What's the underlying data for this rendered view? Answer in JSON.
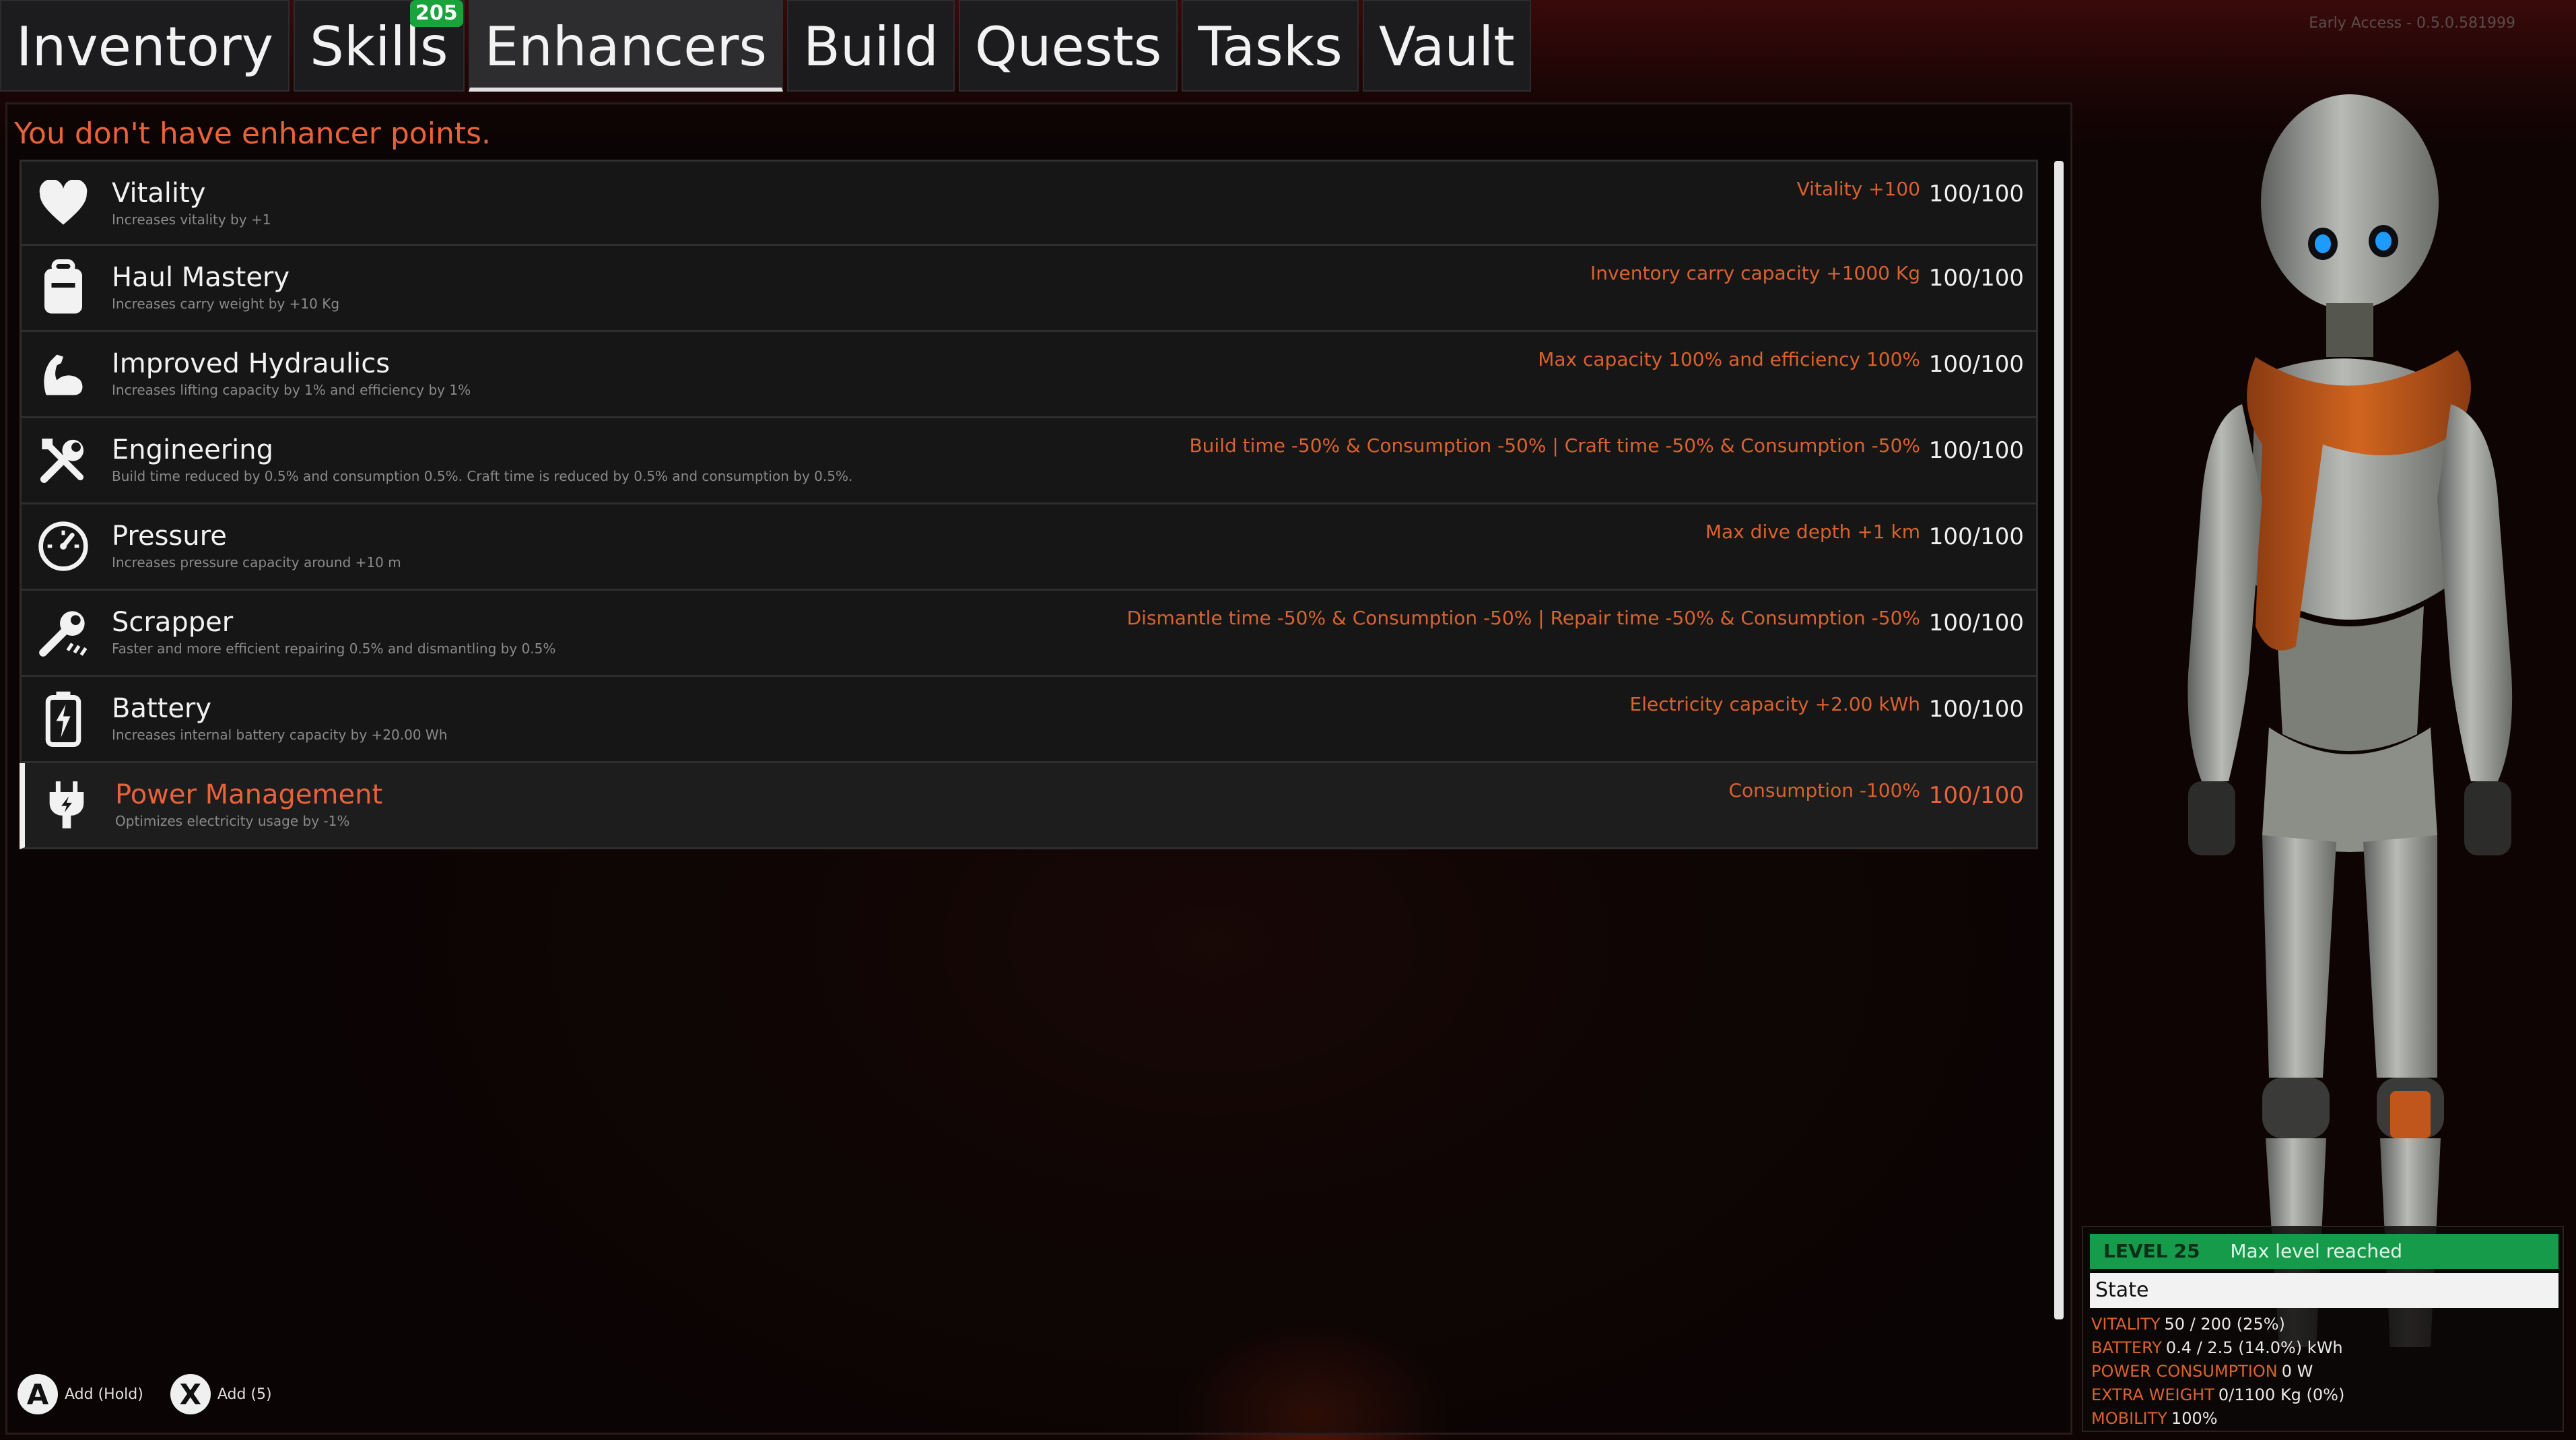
{
  "tabs": [
    {
      "label": "Inventory"
    },
    {
      "label": "Skills",
      "badge": "205"
    },
    {
      "label": "Enhancers",
      "active": true
    },
    {
      "label": "Build"
    },
    {
      "label": "Quests"
    },
    {
      "label": "Tasks"
    },
    {
      "label": "Vault"
    }
  ],
  "version": "Early Access - 0.5.0.581999",
  "warning": "You don't have enhancer points.",
  "enhancers": [
    {
      "name": "Vitality",
      "desc": "Increases vitality by +1",
      "effect": "Vitality +100",
      "level": "100/100",
      "icon": "heart-icon"
    },
    {
      "name": "Haul Mastery",
      "desc": "Increases carry weight by +10 Kg",
      "effect": "Inventory carry capacity +1000 Kg",
      "level": "100/100",
      "icon": "backpack-icon"
    },
    {
      "name": "Improved Hydraulics",
      "desc": "Increases lifting capacity by 1% and efficiency by 1%",
      "effect": "Max capacity 100% and efficiency 100%",
      "level": "100/100",
      "icon": "flexed-arm-icon"
    },
    {
      "name": "Engineering",
      "desc": "Build time reduced by 0.5% and consumption 0.5%. Craft time is reduced by 0.5% and consumption by 0.5%.",
      "effect": "Build time -50% & Consumption -50% | Craft time -50% & Consumption -50%",
      "level": "100/100",
      "icon": "tools-icon"
    },
    {
      "name": "Pressure",
      "desc": "Increases pressure capacity around +10 m",
      "effect": "Max dive depth +1 km",
      "level": "100/100",
      "icon": "gauge-icon"
    },
    {
      "name": "Scrapper",
      "desc": "Faster and more efficient repairing 0.5% and dismantling by 0.5%",
      "effect": "Dismantle time -50% & Consumption -50% | Repair time -50% & Consumption -50%",
      "level": "100/100",
      "icon": "wrench-icon"
    },
    {
      "name": "Battery",
      "desc": "Increases internal battery capacity by +20.00 Wh",
      "effect": "Electricity capacity +2.00 kWh",
      "level": "100/100",
      "icon": "battery-icon"
    },
    {
      "name": "Power Management",
      "desc": "Optimizes electricity usage by -1%",
      "effect": "Consumption -100%",
      "level": "100/100",
      "icon": "plug-icon",
      "selected": true
    }
  ],
  "controls": [
    {
      "button": "A",
      "label": "Add (Hold)"
    },
    {
      "button": "X",
      "label": "Add (5)"
    }
  ],
  "stats": {
    "level_label": "LEVEL",
    "level_value": "25",
    "max_text": "Max level reached",
    "state_label": "State",
    "rows": [
      {
        "key": "VITALITY",
        "value": "50 / 200 (25%)"
      },
      {
        "key": "BATTERY",
        "value": "0.4 / 2.5 (14.0%) kWh"
      },
      {
        "key": "POWER CONSUMPTION",
        "value": "0 W"
      },
      {
        "key": "EXTRA WEIGHT",
        "value": "0/1100 Kg (0%)"
      },
      {
        "key": "MOBILITY",
        "value": "100%"
      }
    ]
  },
  "colors": {
    "accent": "#e8623a",
    "level_green": "#159b4a",
    "effect_orange": "#d9622e"
  }
}
